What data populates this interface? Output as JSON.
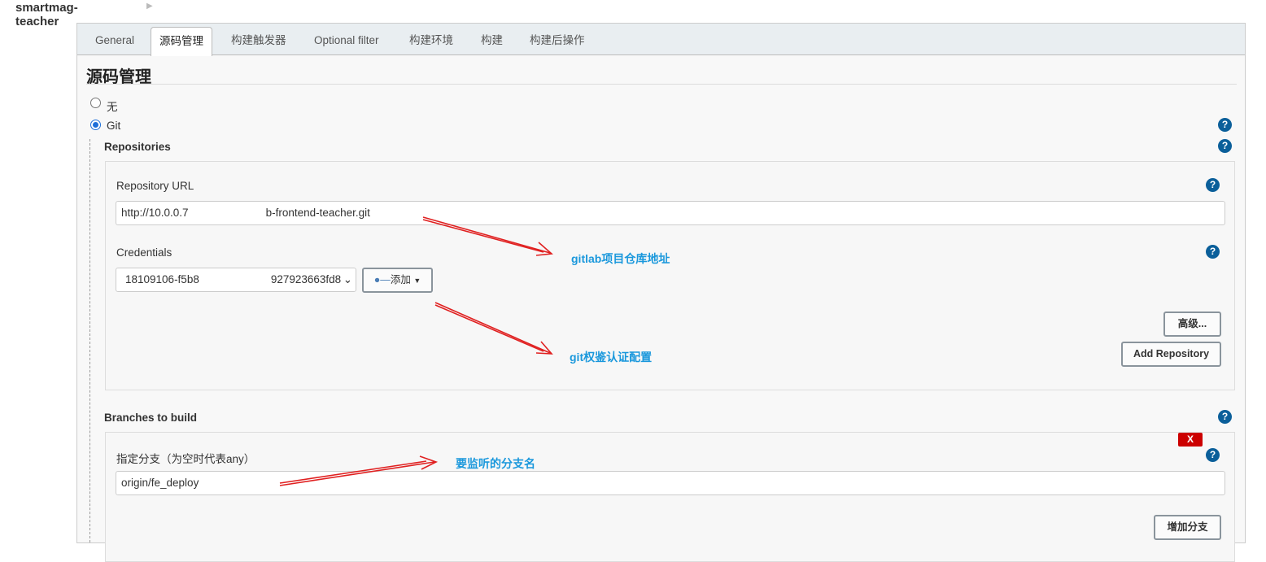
{
  "breadcrumb": {
    "project": "smartmag-teacher"
  },
  "tabs": [
    {
      "label": "General"
    },
    {
      "label": "源码管理"
    },
    {
      "label": "构建触发器"
    },
    {
      "label": "Optional filter"
    },
    {
      "label": "构建环境"
    },
    {
      "label": "构建"
    },
    {
      "label": "构建后操作"
    }
  ],
  "section": {
    "title": "源码管理",
    "option_none": "无",
    "option_git": "Git",
    "repositories_label": "Repositories",
    "repo_url_label": "Repository URL",
    "repo_url_value_start": "http://10.0.0.7",
    "repo_url_value_end": "b-frontend-teacher.git",
    "credentials_label": "Credentials",
    "credentials_value_start": "18109106-f5b8",
    "credentials_value_end": "927923663fd8",
    "add_button": "添加",
    "advanced_button": "高级...",
    "add_repository_button": "Add Repository",
    "branches_label": "Branches to build",
    "branch_spec_label": "指定分支（为空时代表any）",
    "branch_value": "origin/fe_deploy",
    "delete_branch": "X",
    "add_branch_button": "增加分支"
  },
  "annotations": {
    "repo": "gitlab项目仓库地址",
    "auth": "git权鉴认证配置",
    "branch": "要监听的分支名",
    "color": "#1a98dc",
    "arrow_color": "#e02020"
  }
}
